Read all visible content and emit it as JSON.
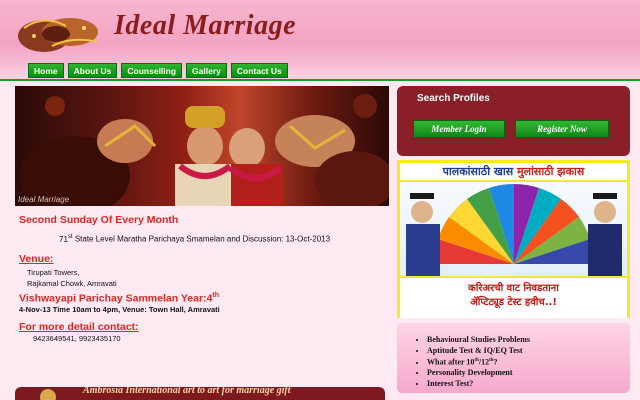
{
  "brand": {
    "name": "Ideal Marriage"
  },
  "nav": [
    "Home",
    "About Us",
    "Counselling",
    "Gallery",
    "Contact Us"
  ],
  "hero": {
    "caption": "Ideal Marriage"
  },
  "event": {
    "heading": "Second Sunday Of Every Month",
    "line1_num": "71",
    "line1_sup": "st",
    "line1_rest": "State Level Maratha Parichaya Smamelan and Discussion: 13-Oct-2013",
    "venue_label": "Venue:",
    "venue_line1": "Tirupati Towers,",
    "venue_line2": "Rajkamal Chowk, Amravati",
    "vish_heading": "Vishwayapi Parichay Sammelan Year:4",
    "vish_sup": "th",
    "vish_line": "4-Nov-13 Time 10am to 4pm, Venue: Town Hall, Amravati",
    "contact_label": "For more detail contact:",
    "contact_numbers": "9423649541, 9923435170"
  },
  "search": {
    "title": "Search Profiles",
    "member_login": "Member Login",
    "register_now": "Register Now"
  },
  "banner": {
    "head_a": "पालकांसाठी खास",
    "head_b": "मुलांसाठी झकास",
    "foot_line1": "करिअरची वाट निवडताना",
    "foot_line2": "ॲप्टिट्यूड टेस्ट हवीच..!"
  },
  "services": [
    "Behavioural Studies Problems",
    "Aptitude Test & IQ/EQ Test",
    "What after 10th/12th?",
    "Personality Development",
    "Interest Test?"
  ],
  "bottom_strip": {
    "text": "Ambrosia International art to art for marriage gift"
  }
}
